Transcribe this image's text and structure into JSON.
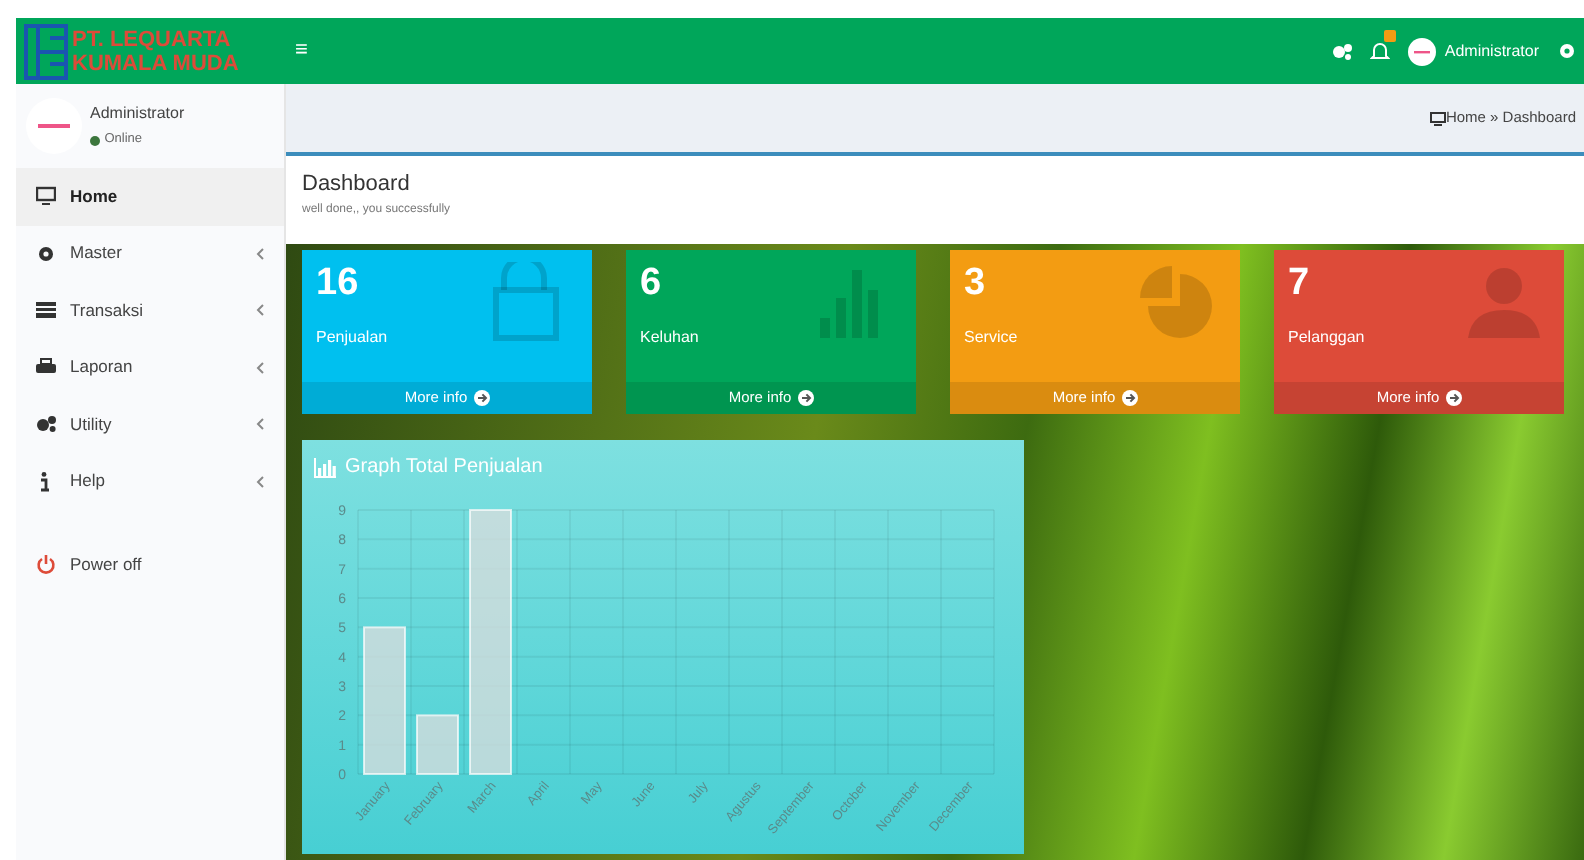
{
  "header": {
    "brand": [
      "PT. LEQUARTA",
      "KUMALA MUDA"
    ],
    "menu_toggle": "≡",
    "user_name": "Administrator"
  },
  "sidebar": {
    "user": {
      "name": "Administrator",
      "status": "Online"
    },
    "items": [
      {
        "label": "Home",
        "selected": true,
        "expandable": false,
        "kind": "menu"
      },
      {
        "label": "Master",
        "selected": false,
        "expandable": true,
        "kind": "menu"
      },
      {
        "label": "Transaksi",
        "selected": false,
        "expandable": true,
        "kind": "menu"
      },
      {
        "label": "Laporan",
        "selected": false,
        "expandable": true,
        "kind": "menu"
      },
      {
        "label": "Utility",
        "selected": false,
        "expandable": true,
        "kind": "menu"
      },
      {
        "label": "Help",
        "selected": false,
        "expandable": true,
        "kind": "menu"
      },
      {
        "label": "Power off",
        "selected": false,
        "expandable": false,
        "kind": "logout"
      }
    ]
  },
  "breadcrumb": "Home » Dashboard",
  "page": {
    "title": "Dashboard",
    "subtitle": "well done,, you successfully"
  },
  "stat_cards": [
    {
      "value": "16",
      "label": "Penjualan",
      "link": "More info",
      "color": "#00c0ef"
    },
    {
      "value": "6",
      "label": "Keluhan",
      "link": "More info",
      "color": "#00a65a"
    },
    {
      "value": "3",
      "label": "Service",
      "link": "More info",
      "color": "#f39c12"
    },
    {
      "value": "7",
      "label": "Pelanggan",
      "link": "More info",
      "color": "#dd4b39"
    }
  ],
  "chart_panel": {
    "title": "Graph Total Penjualan",
    "chart_data": {
      "type": "bar",
      "categories": [
        "January",
        "February",
        "March",
        "April",
        "May",
        "June",
        "July",
        "Agustus",
        "September",
        "October",
        "November",
        "December"
      ],
      "values": [
        5,
        2,
        9,
        0,
        0,
        0,
        0,
        0,
        0,
        0,
        0,
        0
      ],
      "ylim": [
        0,
        9
      ],
      "grid": true,
      "yticks": [
        0,
        1,
        2,
        3,
        4,
        5,
        6,
        7,
        8,
        9
      ]
    }
  }
}
